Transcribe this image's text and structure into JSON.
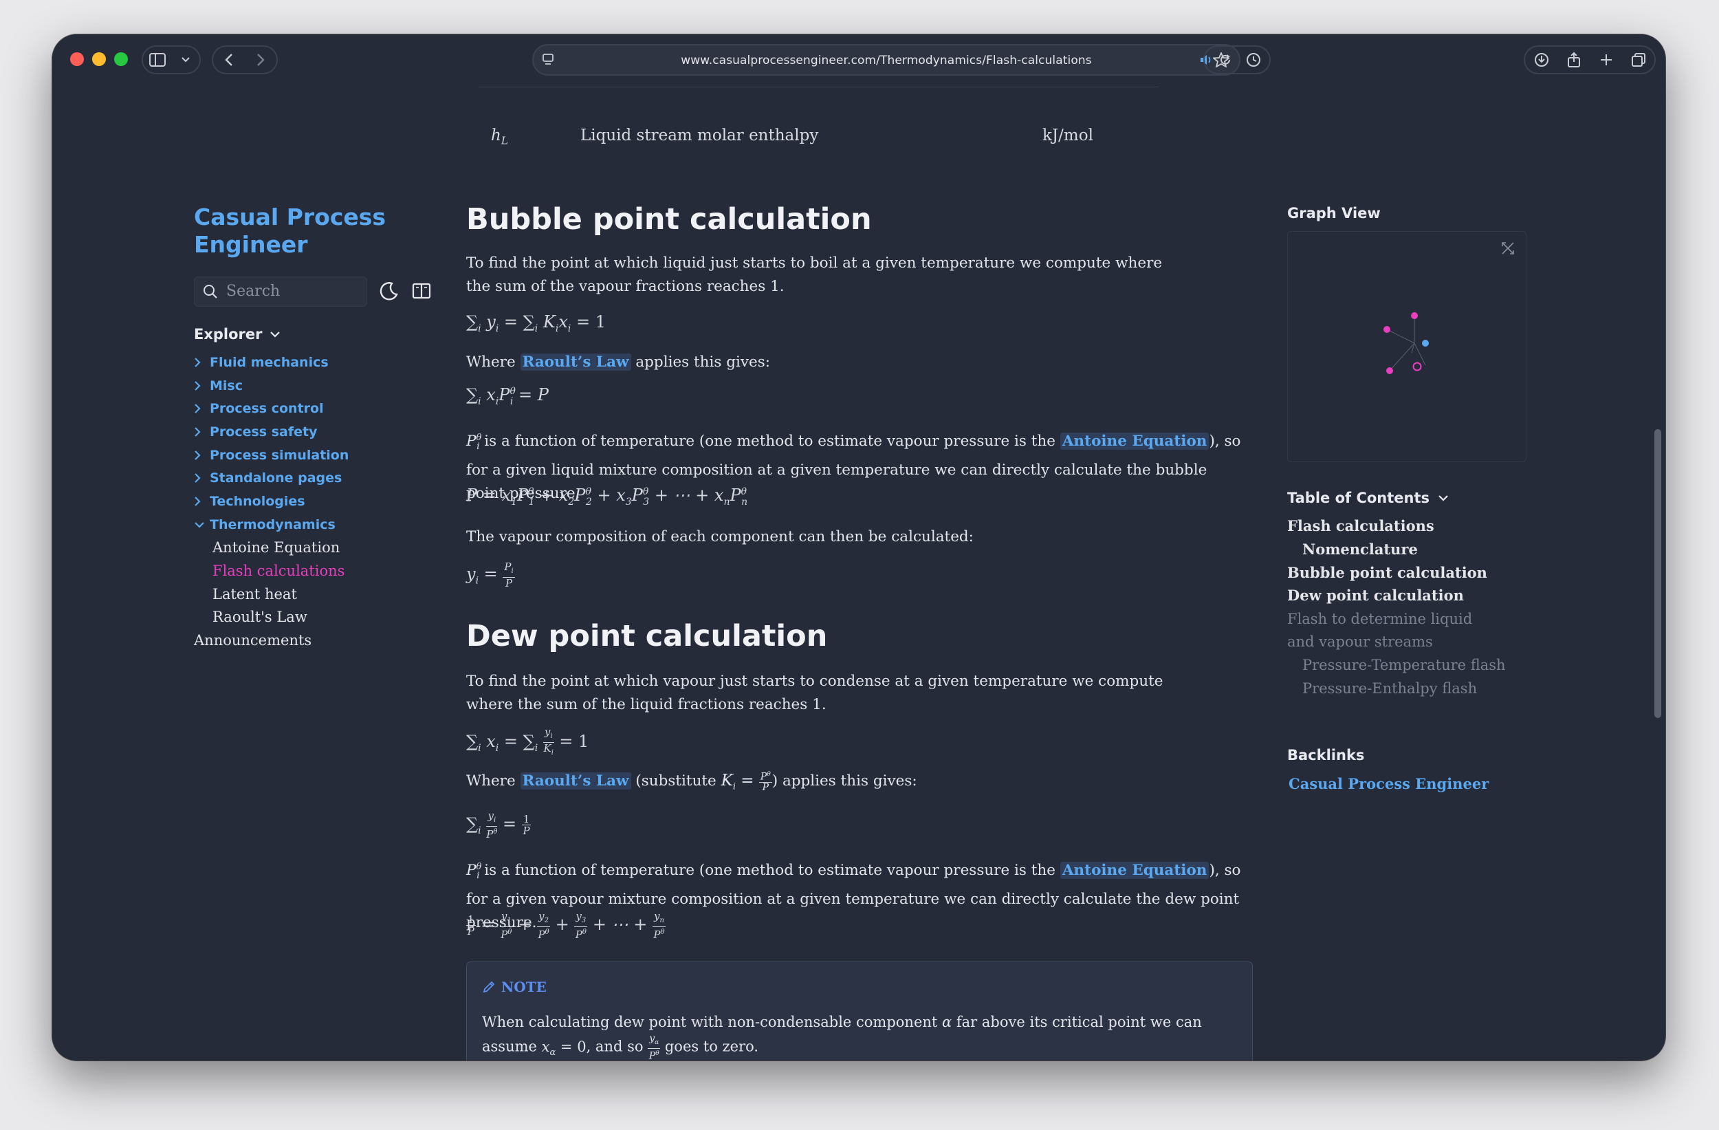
{
  "browser": {
    "url": "www.casualprocessengineer.com/Thermodynamics/Flash-calculations"
  },
  "top_row": {
    "symbol": "h",
    "symbol_sub": "L",
    "description": "Liquid stream molar enthalpy",
    "unit": "kJ/mol"
  },
  "sidebar": {
    "brand": "Casual Process Engineer",
    "search_placeholder": "Search",
    "explorer_label": "Explorer",
    "folders": [
      "Fluid mechanics",
      "Misc",
      "Process control",
      "Process safety",
      "Process simulation",
      "Standalone pages",
      "Technologies",
      "Thermodynamics"
    ],
    "thermo_children": [
      "Antoine Equation",
      "Flash calculations",
      "Latent heat",
      "Raoult's Law"
    ],
    "announcements": "Announcements"
  },
  "article": {
    "bubble": {
      "heading": "Bubble point calculation",
      "p1": "To find the point at which liquid just starts to boil at a given temperature we compute where the sum of the vapour fractions reaches 1.",
      "where_prefix": "Where ",
      "link_raoult": "Raoult’s Law",
      "where_suffix": " applies this gives:",
      "p3_mid": " is a function of temperature (one method to estimate vapour pressure is the ",
      "link_antoine": "Antoine Equation",
      "p3_end": "), so for a given liquid mixture composition at a given temperature we can directly calculate the bubble point pressure.",
      "p4": "The vapour composition of each component can then be calculated:"
    },
    "dew": {
      "heading": "Dew point calculation",
      "p1": "To find the point at which vapour just starts to condense at a given temperature we compute where the sum of the liquid fractions reaches 1.",
      "where_prefix": "Where ",
      "link_raoult": "Raoult’s Law",
      "where_mid": " (substitute ",
      "where_suffix": ") applies this gives:",
      "p3_mid": " is a function of temperature (one method to estimate vapour pressure is the ",
      "link_antoine": "Antoine Equation",
      "p3_end": "), so for a given vapour mixture composition at a given temperature we can directly calculate the dew point pressure."
    },
    "note": {
      "title": "NOTE",
      "text_a": "When calculating dew point with non-condensable component ",
      "text_b": " far above its critical point we can assume ",
      "text_c": ", and so ",
      "text_d": " goes to zero."
    }
  },
  "right": {
    "graph_title": "Graph View",
    "toc_title": "Table of Contents",
    "toc": [
      {
        "label": "Flash calculations",
        "level": 0,
        "dim": false
      },
      {
        "label": "Nomenclature",
        "level": 1,
        "dim": false
      },
      {
        "label": "Bubble point calculation",
        "level": 0,
        "dim": false
      },
      {
        "label": "Dew point calculation",
        "level": 0,
        "dim": false
      },
      {
        "label": "Flash to determine liquid",
        "level": 0,
        "dim": true
      },
      {
        "label": "and vapour streams",
        "level": 0,
        "dim": true
      },
      {
        "label": "Pressure-Temperature flash",
        "level": 1,
        "dim": true
      },
      {
        "label": "Pressure-Enthalpy flash",
        "level": 1,
        "dim": true
      }
    ],
    "backlinks_title": "Backlinks",
    "backlink": "Casual Process Engineer"
  },
  "colors": {
    "accent": "#5aa8f0",
    "active": "#e83fbe",
    "background": "#262b39"
  }
}
